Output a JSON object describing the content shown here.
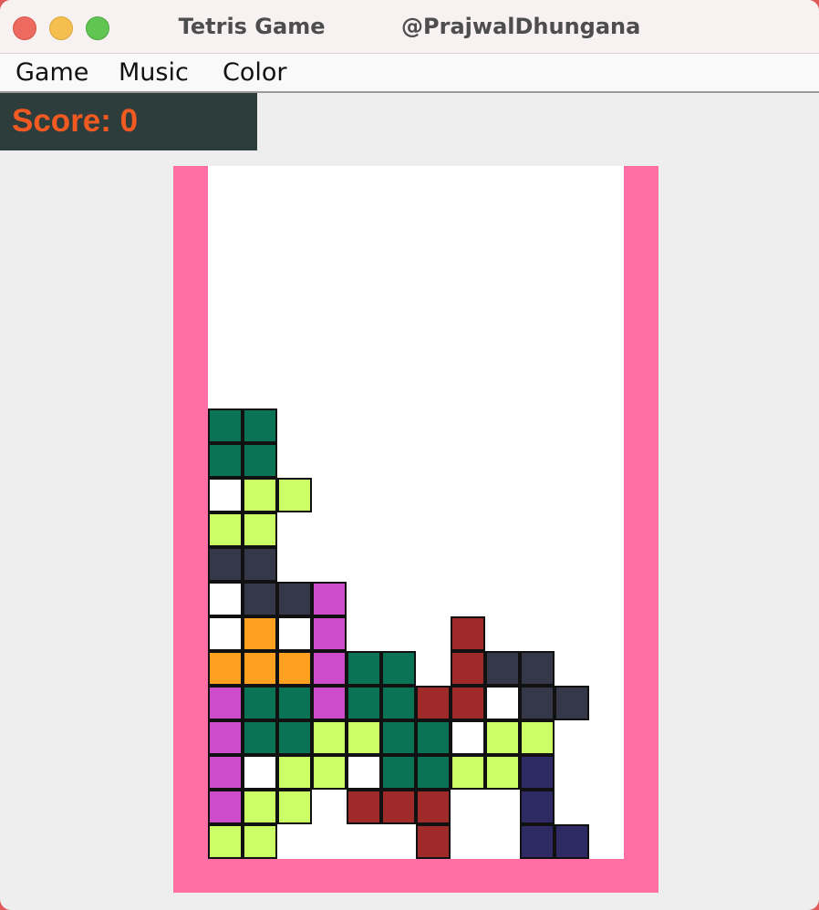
{
  "window": {
    "title": "Tetris Game          @PrajwalDhungana"
  },
  "menu": {
    "items": [
      {
        "label": "Game"
      },
      {
        "label": "Music"
      },
      {
        "label": "Color"
      }
    ]
  },
  "score": {
    "label": "Score: 0"
  },
  "colors": {
    "frame": "#ff6fa4",
    "board": "#ffffff",
    "score_bg": "#2d3d3b",
    "score_text": "#f25a22"
  },
  "board": {
    "columns": 12,
    "rows": 20,
    "filled_cells": [
      {
        "col": 0,
        "row": 7,
        "color": "#0b7355"
      },
      {
        "col": 1,
        "row": 7,
        "color": "#0b7355"
      },
      {
        "col": 0,
        "row": 8,
        "color": "#0b7355"
      },
      {
        "col": 1,
        "row": 8,
        "color": "#0b7355"
      },
      {
        "col": 1,
        "row": 9,
        "color": "#ccff66"
      },
      {
        "col": 2,
        "row": 9,
        "color": "#ccff66"
      },
      {
        "col": 0,
        "row": 10,
        "color": "#ccff66"
      },
      {
        "col": 1,
        "row": 10,
        "color": "#ccff66"
      },
      {
        "col": 0,
        "row": 11,
        "color": "#353848"
      },
      {
        "col": 1,
        "row": 11,
        "color": "#353848"
      },
      {
        "col": 1,
        "row": 12,
        "color": "#353848"
      },
      {
        "col": 2,
        "row": 12,
        "color": "#353848"
      },
      {
        "col": 3,
        "row": 12,
        "color": "#cc4ccc"
      },
      {
        "col": 1,
        "row": 13,
        "color": "#ffa020"
      },
      {
        "col": 3,
        "row": 13,
        "color": "#cc4ccc"
      },
      {
        "col": 7,
        "row": 13,
        "color": "#9e2a2a"
      },
      {
        "col": 0,
        "row": 14,
        "color": "#ffa020"
      },
      {
        "col": 1,
        "row": 14,
        "color": "#ffa020"
      },
      {
        "col": 2,
        "row": 14,
        "color": "#ffa020"
      },
      {
        "col": 3,
        "row": 14,
        "color": "#cc4ccc"
      },
      {
        "col": 4,
        "row": 14,
        "color": "#0b7355"
      },
      {
        "col": 5,
        "row": 14,
        "color": "#0b7355"
      },
      {
        "col": 7,
        "row": 14,
        "color": "#9e2a2a"
      },
      {
        "col": 8,
        "row": 14,
        "color": "#353848"
      },
      {
        "col": 9,
        "row": 14,
        "color": "#353848"
      },
      {
        "col": 0,
        "row": 15,
        "color": "#cc4ccc"
      },
      {
        "col": 1,
        "row": 15,
        "color": "#0b7355"
      },
      {
        "col": 2,
        "row": 15,
        "color": "#0b7355"
      },
      {
        "col": 3,
        "row": 15,
        "color": "#cc4ccc"
      },
      {
        "col": 4,
        "row": 15,
        "color": "#0b7355"
      },
      {
        "col": 5,
        "row": 15,
        "color": "#0b7355"
      },
      {
        "col": 6,
        "row": 15,
        "color": "#9e2a2a"
      },
      {
        "col": 7,
        "row": 15,
        "color": "#9e2a2a"
      },
      {
        "col": 9,
        "row": 15,
        "color": "#353848"
      },
      {
        "col": 10,
        "row": 15,
        "color": "#353848"
      },
      {
        "col": 0,
        "row": 16,
        "color": "#cc4ccc"
      },
      {
        "col": 1,
        "row": 16,
        "color": "#0b7355"
      },
      {
        "col": 2,
        "row": 16,
        "color": "#0b7355"
      },
      {
        "col": 3,
        "row": 16,
        "color": "#ccff66"
      },
      {
        "col": 4,
        "row": 16,
        "color": "#ccff66"
      },
      {
        "col": 5,
        "row": 16,
        "color": "#0b7355"
      },
      {
        "col": 6,
        "row": 16,
        "color": "#0b7355"
      },
      {
        "col": 8,
        "row": 16,
        "color": "#ccff66"
      },
      {
        "col": 9,
        "row": 16,
        "color": "#ccff66"
      },
      {
        "col": 0,
        "row": 17,
        "color": "#cc4ccc"
      },
      {
        "col": 2,
        "row": 17,
        "color": "#ccff66"
      },
      {
        "col": 3,
        "row": 17,
        "color": "#ccff66"
      },
      {
        "col": 5,
        "row": 17,
        "color": "#0b7355"
      },
      {
        "col": 6,
        "row": 17,
        "color": "#0b7355"
      },
      {
        "col": 7,
        "row": 17,
        "color": "#ccff66"
      },
      {
        "col": 8,
        "row": 17,
        "color": "#ccff66"
      },
      {
        "col": 9,
        "row": 17,
        "color": "#2e2a64"
      },
      {
        "col": 0,
        "row": 18,
        "color": "#cc4ccc"
      },
      {
        "col": 1,
        "row": 18,
        "color": "#ccff66"
      },
      {
        "col": 2,
        "row": 18,
        "color": "#ccff66"
      },
      {
        "col": 4,
        "row": 18,
        "color": "#9e2a2a"
      },
      {
        "col": 5,
        "row": 18,
        "color": "#9e2a2a"
      },
      {
        "col": 6,
        "row": 18,
        "color": "#9e2a2a"
      },
      {
        "col": 9,
        "row": 18,
        "color": "#2e2a64"
      },
      {
        "col": 0,
        "row": 19,
        "color": "#ccff66"
      },
      {
        "col": 1,
        "row": 19,
        "color": "#ccff66"
      },
      {
        "col": 6,
        "row": 19,
        "color": "#9e2a2a"
      },
      {
        "col": 9,
        "row": 19,
        "color": "#2e2a64"
      },
      {
        "col": 10,
        "row": 19,
        "color": "#2e2a64"
      }
    ],
    "empty_outlined_cells": [
      {
        "col": 0,
        "row": 9
      },
      {
        "col": 0,
        "row": 12
      },
      {
        "col": 0,
        "row": 13
      },
      {
        "col": 2,
        "row": 13
      },
      {
        "col": 8,
        "row": 15
      },
      {
        "col": 7,
        "row": 16
      },
      {
        "col": 1,
        "row": 17
      },
      {
        "col": 4,
        "row": 17
      }
    ]
  }
}
